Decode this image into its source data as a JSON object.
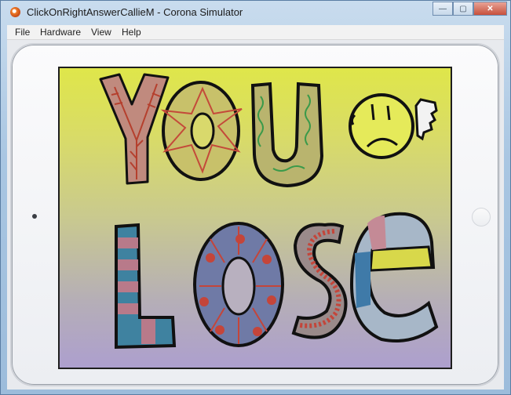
{
  "window": {
    "title": "ClickOnRightAnswerCallieM - Corona Simulator",
    "controls": {
      "minimize": "—",
      "maximize": "▢",
      "close": "✕"
    }
  },
  "menu": {
    "items": [
      "File",
      "Hardware",
      "View",
      "Help"
    ]
  },
  "game": {
    "message_line1": "YOU",
    "message_line2": "LOSE",
    "icons": [
      "sad-face-icon",
      "thumbs-down-icon"
    ]
  },
  "colors": {
    "screen_top": "#dfe64a",
    "screen_bottom": "#ad9fce",
    "letter_outline": "#111111",
    "accent_red": "#c44a3a"
  }
}
